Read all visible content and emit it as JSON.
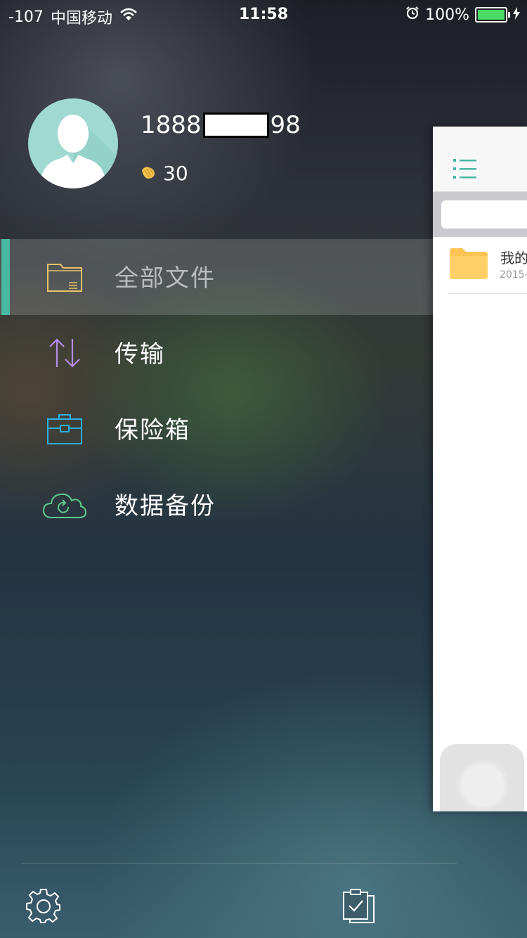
{
  "status_bar": {
    "signal": "-107",
    "carrier": "中国移动",
    "time": "11:58",
    "battery_percent": "100%",
    "battery_level": 1.0
  },
  "profile": {
    "username_prefix": "1888",
    "username_suffix": "98",
    "points": "30"
  },
  "menu": {
    "items": [
      {
        "label": "全部文件",
        "icon": "folder-icon",
        "active": true
      },
      {
        "label": "传输",
        "icon": "transfer-arrows-icon",
        "active": false
      },
      {
        "label": "保险箱",
        "icon": "briefcase-icon",
        "active": false
      },
      {
        "label": "数据备份",
        "icon": "cloud-sync-icon",
        "active": false
      }
    ]
  },
  "bottom_bar": {
    "left_icon": "gear-icon",
    "right_icon": "clipboard-check-icon"
  },
  "peek_panel": {
    "header_icon": "list-icon",
    "file_name": "我的",
    "file_date": "2015-"
  },
  "colors": {
    "accent": "#48b8a0",
    "folder": "#e8c46a",
    "transfer": "#b58be8",
    "briefcase": "#2bb0e6",
    "cloud": "#5ec98e",
    "battery": "#4cd964"
  }
}
